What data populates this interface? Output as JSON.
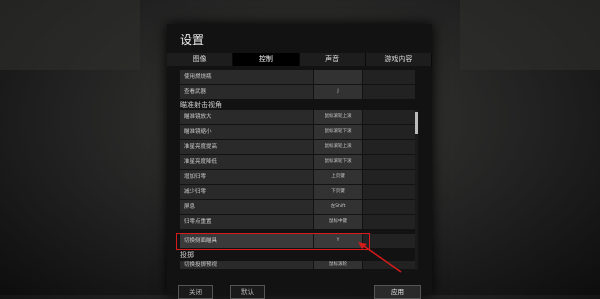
{
  "dialog": {
    "title": "设置"
  },
  "tabs": [
    "图像",
    "控制",
    "声音",
    "游戏内容"
  ],
  "rows_top": [
    {
      "label": "使用燃烧瓶",
      "key1": "",
      "key2": ""
    },
    {
      "label": "查看武器",
      "key1": "J",
      "key2": ""
    }
  ],
  "section_scope": "瞄准射击视角",
  "rows_scope": [
    {
      "label": "瞄准镜放大",
      "key1": "鼠标滚轮上滚",
      "key2": ""
    },
    {
      "label": "瞄准镜缩小",
      "key1": "鼠标滚轮下滚",
      "key2": ""
    },
    {
      "label": "准星亮度提高",
      "key1": "鼠标滚轮上滚",
      "key2": ""
    },
    {
      "label": "准星亮度降低",
      "key1": "鼠标滚轮下滚",
      "key2": ""
    },
    {
      "label": "增加归零",
      "key1": "上页键",
      "key2": ""
    },
    {
      "label": "减少归零",
      "key1": "下页键",
      "key2": ""
    },
    {
      "label": "屏息",
      "key1": "左Shift",
      "key2": ""
    },
    {
      "label": "归零点重置",
      "key1": "鼠标中键",
      "key2": ""
    },
    {
      "label": "切换侧面瞄具",
      "key1": "Y",
      "key2": ""
    }
  ],
  "section_throw": "投掷",
  "rows_throw": [
    {
      "label": "切换投掷预视",
      "key1": "鼠标滚轮",
      "key2": ""
    }
  ],
  "buttons": {
    "close": "关闭",
    "default": "默认",
    "confirm": "应用"
  },
  "colors": {
    "highlight_box": "#d61b1b"
  }
}
